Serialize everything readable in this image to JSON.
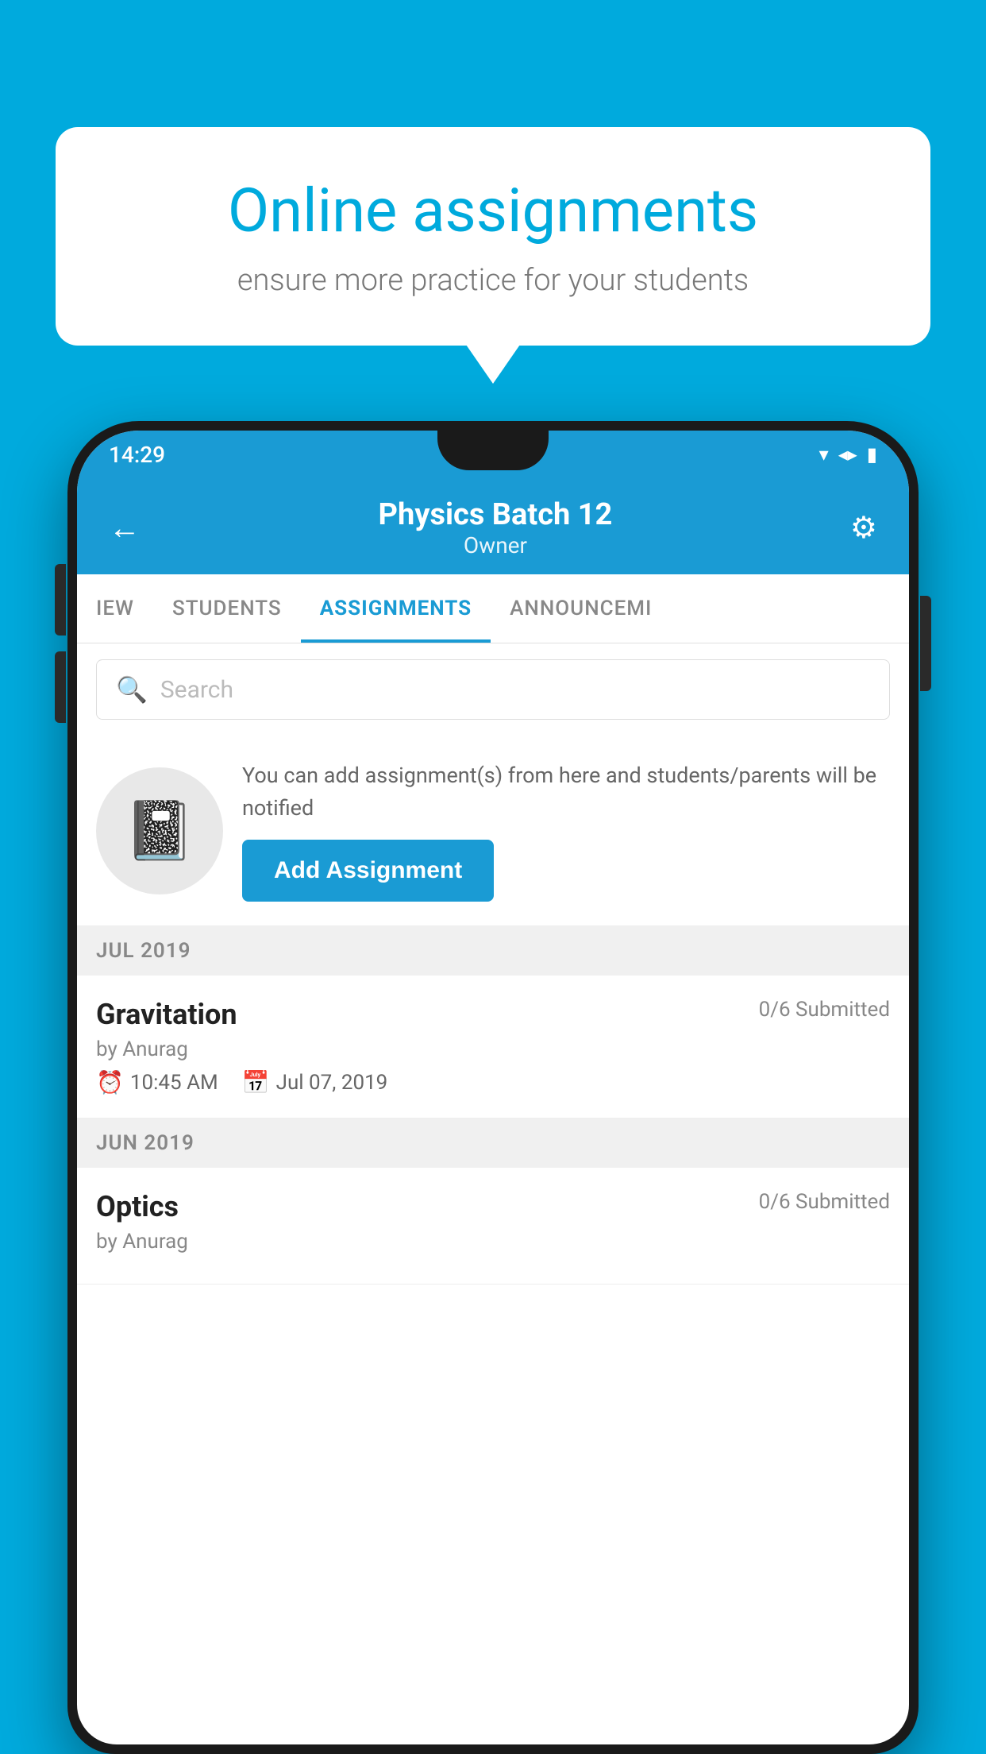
{
  "background": {
    "color": "#00AADD"
  },
  "speech_bubble": {
    "title": "Online assignments",
    "subtitle": "ensure more practice for your students"
  },
  "status_bar": {
    "time": "14:29",
    "wifi": "▲",
    "signal": "▲",
    "battery": "▮"
  },
  "app_header": {
    "title": "Physics Batch 12",
    "subtitle": "Owner",
    "back_label": "←",
    "settings_label": "⚙"
  },
  "tabs": [
    {
      "label": "IEW",
      "active": false
    },
    {
      "label": "STUDENTS",
      "active": false
    },
    {
      "label": "ASSIGNMENTS",
      "active": true
    },
    {
      "label": "ANNOUNCEMI",
      "active": false
    }
  ],
  "search": {
    "placeholder": "Search"
  },
  "add_assignment": {
    "description": "You can add assignment(s) from here and students/parents will be notified",
    "button_label": "Add Assignment"
  },
  "months": [
    {
      "label": "JUL 2019",
      "assignments": [
        {
          "name": "Gravitation",
          "submitted": "0/6 Submitted",
          "author": "by Anurag",
          "time": "10:45 AM",
          "date": "Jul 07, 2019"
        }
      ]
    },
    {
      "label": "JUN 2019",
      "assignments": [
        {
          "name": "Optics",
          "submitted": "0/6 Submitted",
          "author": "by Anurag",
          "time": "",
          "date": ""
        }
      ]
    }
  ]
}
